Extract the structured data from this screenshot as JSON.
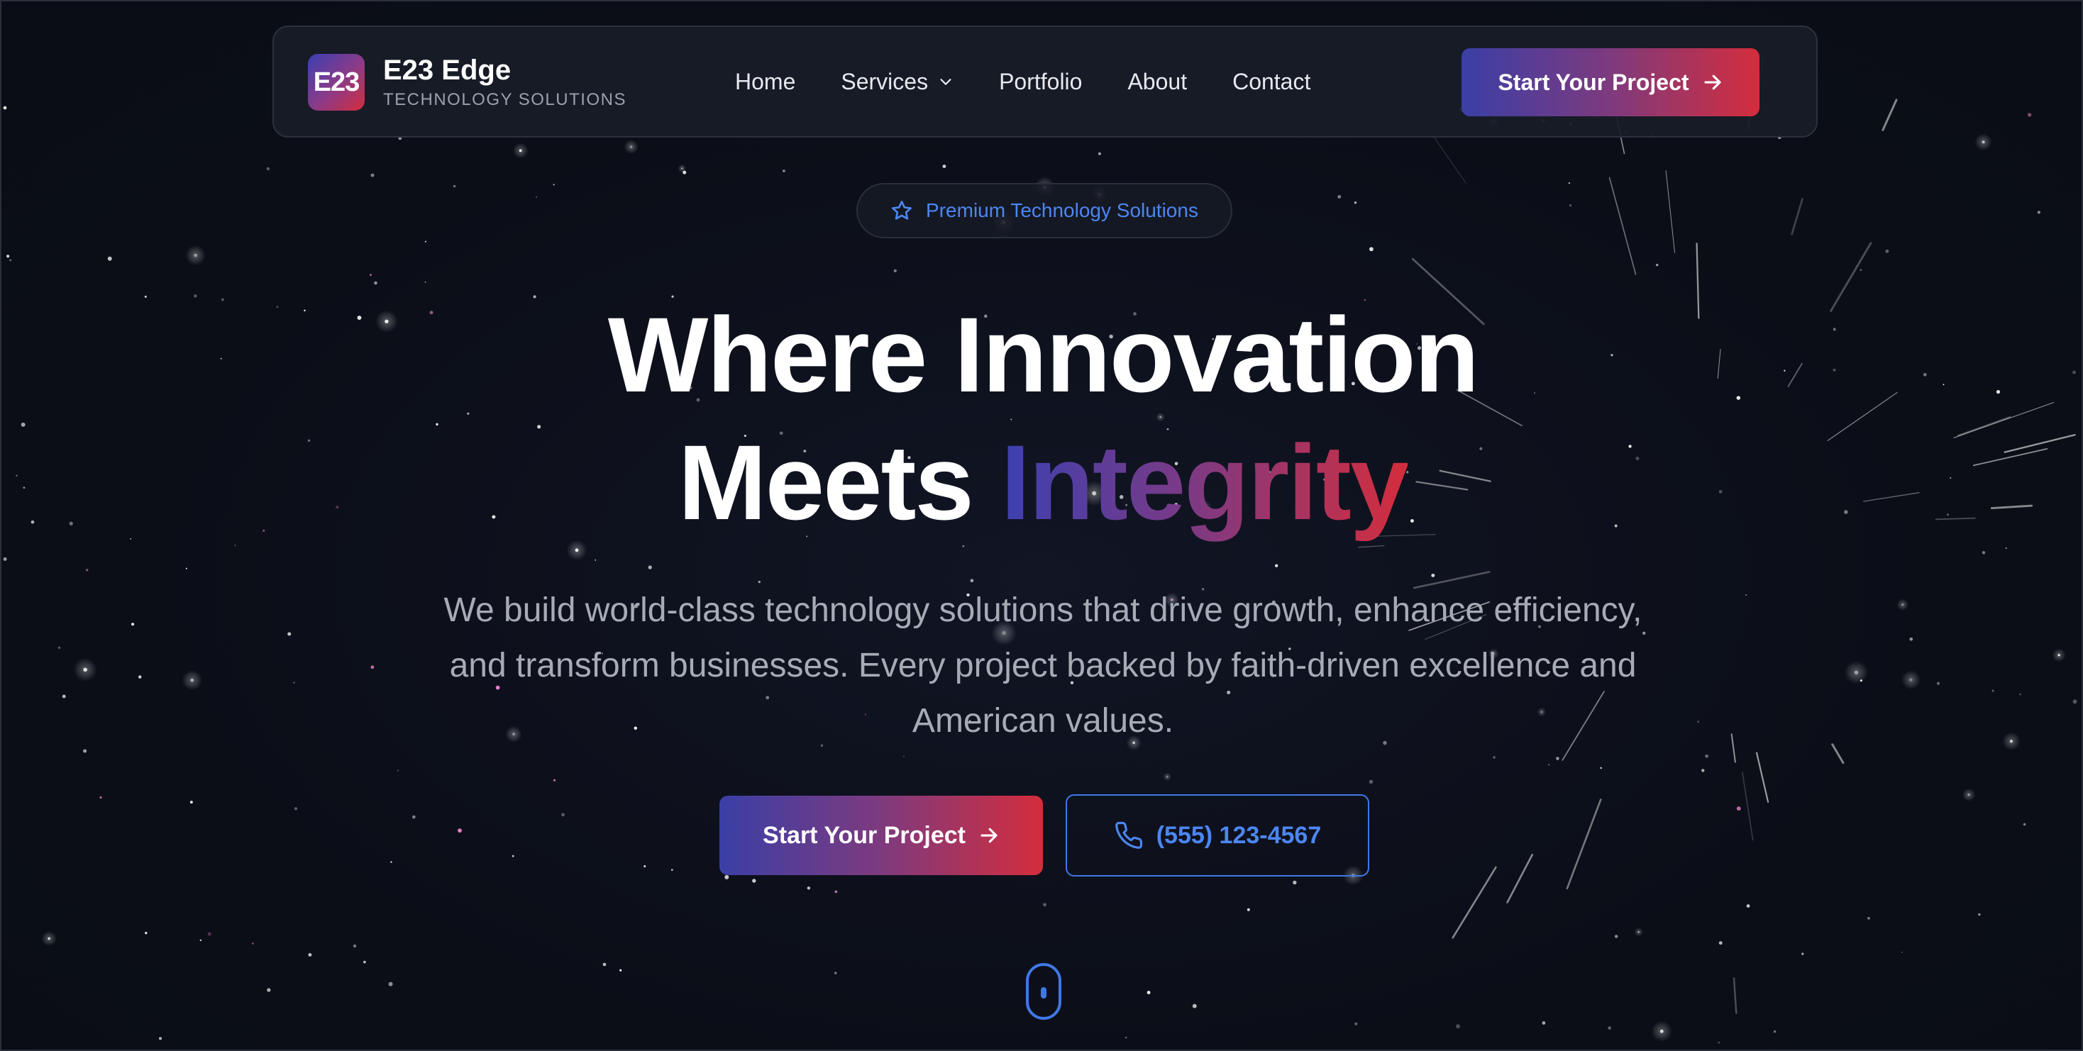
{
  "brand": {
    "logo_text": "E23",
    "name": "E23 Edge",
    "tagline": "TECHNOLOGY SOLUTIONS"
  },
  "nav": {
    "links": [
      "Home",
      "Services",
      "Portfolio",
      "About",
      "Contact"
    ],
    "services_icon": "chevron-down-icon",
    "cta_label": "Start Your Project",
    "cta_icon": "arrow-right-icon"
  },
  "hero": {
    "badge_icon": "star-icon",
    "badge_text": "Premium Technology Solutions",
    "headline_line1": "Where Innovation",
    "headline_line2_plain": "Meets",
    "headline_line2_accent": "Integrity",
    "subtext": "We build world-class technology solutions that drive growth, enhance efficiency, and transform businesses. Every project backed by faith-driven excellence and American values.",
    "primary_cta_label": "Start Your Project",
    "phone_icon": "phone-icon",
    "phone_label": "(555) 123-4567",
    "scroll_icon": "mouse-scroll-icon"
  },
  "colors": {
    "background": "#0b0e17",
    "accent_blue": "#4c86f2",
    "gradient_start": "#3a3fa6",
    "gradient_end": "#d42d3c"
  }
}
